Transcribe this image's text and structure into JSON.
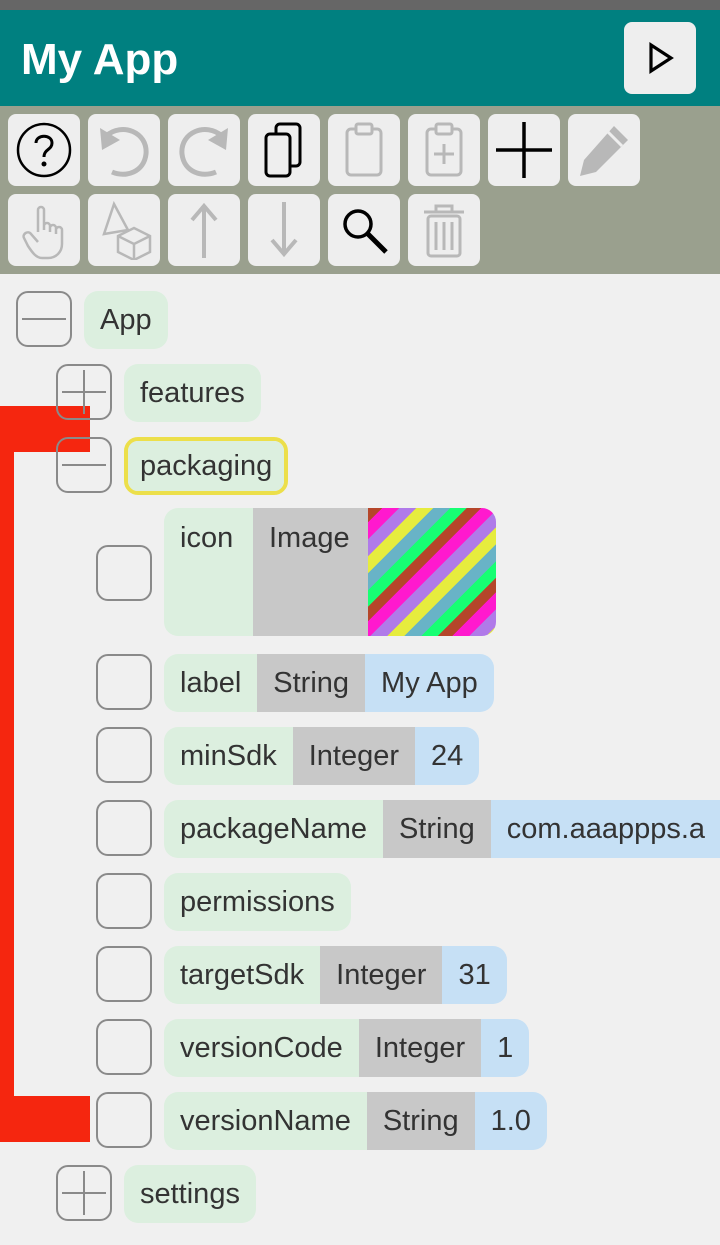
{
  "titlebar": {
    "title": "My App",
    "run_icon": "play-icon"
  },
  "toolbar": {
    "buttons": [
      {
        "name": "help-button",
        "icon": "help-icon",
        "enabled": true
      },
      {
        "name": "undo-button",
        "icon": "undo-icon",
        "enabled": false
      },
      {
        "name": "redo-button",
        "icon": "redo-icon",
        "enabled": false
      },
      {
        "name": "copy-button",
        "icon": "copy-icon",
        "enabled": true
      },
      {
        "name": "paste-button",
        "icon": "clipboard-icon",
        "enabled": false
      },
      {
        "name": "paste-add-button",
        "icon": "clipboard-plus-icon",
        "enabled": false
      },
      {
        "name": "add-button",
        "icon": "plus-icon",
        "enabled": true
      },
      {
        "name": "edit-button",
        "icon": "pencil-icon",
        "enabled": false
      },
      {
        "name": "touch-button",
        "icon": "hand-pointer-icon",
        "enabled": false
      },
      {
        "name": "shapes-button",
        "icon": "shapes-icon",
        "enabled": false
      },
      {
        "name": "move-up-button",
        "icon": "arrow-up-icon",
        "enabled": false
      },
      {
        "name": "move-down-button",
        "icon": "arrow-down-icon",
        "enabled": false
      },
      {
        "name": "search-button",
        "icon": "search-icon",
        "enabled": true
      },
      {
        "name": "delete-button",
        "icon": "trash-icon",
        "enabled": false
      }
    ]
  },
  "tree": {
    "root": {
      "label": "App",
      "expanded": true
    },
    "features": {
      "label": "features",
      "expanded": false
    },
    "packaging": {
      "label": "packaging",
      "expanded": true,
      "selected": true
    },
    "properties": [
      {
        "name": "icon",
        "type": "Image",
        "value": ""
      },
      {
        "name": "label",
        "type": "String",
        "value": "My App"
      },
      {
        "name": "minSdk",
        "type": "Integer",
        "value": "24"
      },
      {
        "name": "packageName",
        "type": "String",
        "value": "com.aaappps.a"
      },
      {
        "name": "permissions",
        "type": "",
        "value": ""
      },
      {
        "name": "targetSdk",
        "type": "Integer",
        "value": "31"
      },
      {
        "name": "versionCode",
        "type": "Integer",
        "value": "1"
      },
      {
        "name": "versionName",
        "type": "String",
        "value": "1.0"
      }
    ],
    "settings": {
      "label": "settings",
      "expanded": false
    }
  },
  "colors": {
    "titlebar": "#008080",
    "toolbar": "#9aa08e",
    "name_chip": "#dcefdf",
    "type_chip": "#c8c8c8",
    "value_chip": "#c6e0f5",
    "selection": "#ecdf4a",
    "guide_bracket": "#f5260f"
  }
}
